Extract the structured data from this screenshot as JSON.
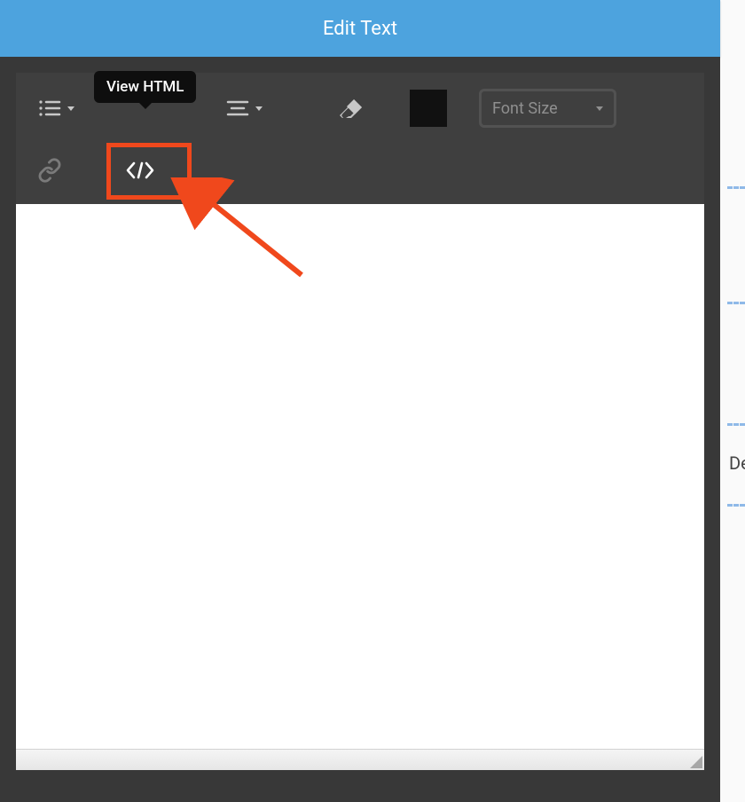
{
  "header": {
    "title": "Edit Text"
  },
  "tooltip": {
    "text": "View HTML"
  },
  "toolbar": {
    "font_size_label": "Font Size"
  },
  "background": {
    "peek_text": "De"
  }
}
